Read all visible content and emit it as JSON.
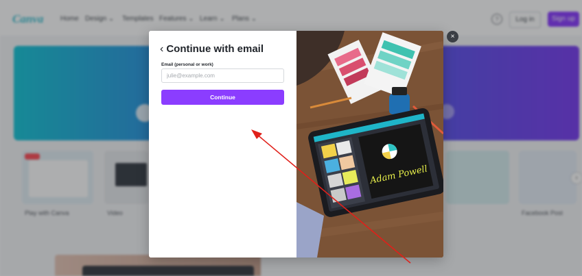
{
  "background": {
    "logo": "Canva",
    "nav": [
      "Home",
      "Design ⌄",
      "Templates",
      "Features ⌄",
      "Learn ⌄",
      "Plans ⌄"
    ],
    "help_glyph": "?",
    "login_label": "Log in",
    "signup_label": "Sign up",
    "cards": [
      "Play with Canva",
      "Video",
      "",
      "",
      "Facebook Post"
    ]
  },
  "modal": {
    "back_icon": "chevron-left-icon",
    "title": "Continue with email",
    "email_label": "Email (personal or work)",
    "email_placeholder": "julie@example.com",
    "email_value": "",
    "continue_label": "Continue",
    "close_glyph": "×",
    "tablet_text": "Adam Powell"
  },
  "colors": {
    "accent": "#8b3dff",
    "annotation_arrow": "#e0201a"
  }
}
